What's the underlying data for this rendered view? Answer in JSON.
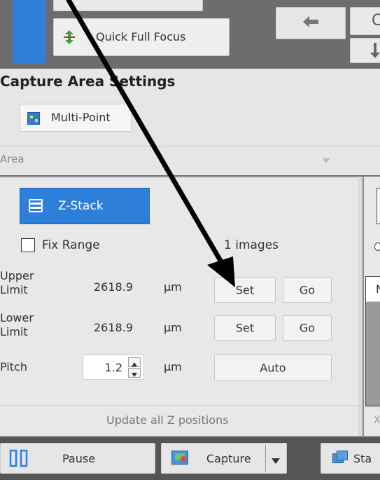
{
  "toolbar": {
    "quick_full_focus": "Quick Full Focus",
    "right_char_top": "C"
  },
  "capture_area": {
    "heading": "Capture Area Settings",
    "multipoint_label": "Multi-Point",
    "area_label": "Area"
  },
  "zstack": {
    "tab_label": "Z-Stack",
    "fix_range_label": "Fix Range",
    "images_count": "1 images",
    "upper_limit_label_1": "Upper",
    "upper_limit_label_2": "Limit",
    "upper_value": "2618.9",
    "upper_unit": "µm",
    "lower_limit_label_1": "Lower",
    "lower_limit_label_2": "Limit",
    "lower_value": "2618.9",
    "lower_unit": "µm",
    "pitch_label": "Pitch",
    "pitch_value": "1.2",
    "pitch_unit": "µm",
    "set_label": "Set",
    "go_label": "Go",
    "auto_label": "Auto",
    "update_label": "Update all Z positions"
  },
  "right_panel": {
    "letter_n": "N",
    "letter_x": "X"
  },
  "bottom": {
    "pause_label": "Pause",
    "capture_label": "Capture",
    "sta_label": "Sta"
  },
  "colors": {
    "accent": "#2e7fd9",
    "panel_bg": "#e6e6e6",
    "dark_top": "#6d6d6d"
  }
}
